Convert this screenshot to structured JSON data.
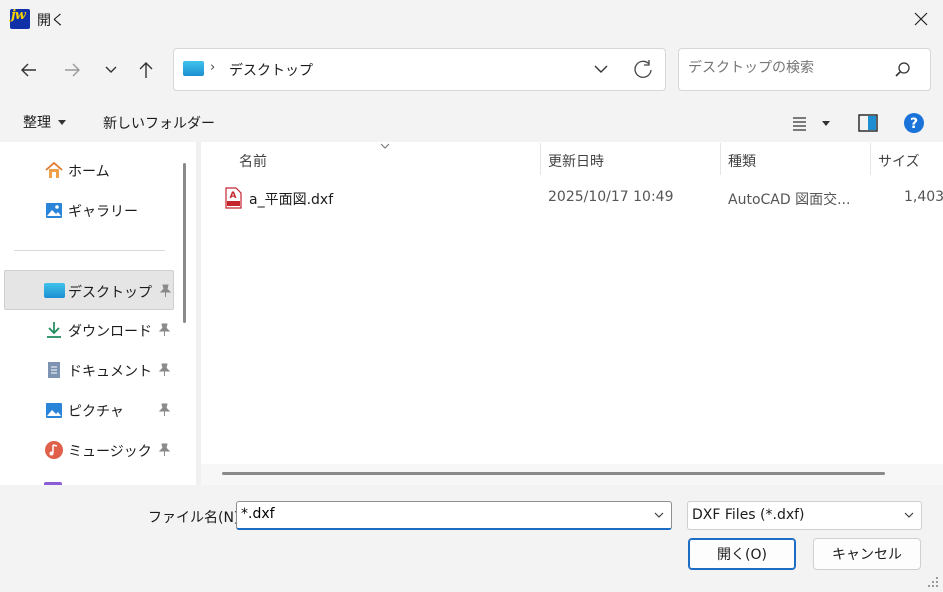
{
  "window": {
    "title": "開く",
    "app_logo_text": "jw"
  },
  "nav_buttons": {
    "back": "arrow-left-icon",
    "forward": "arrow-right-icon",
    "recent": "chevron-down-icon",
    "up": "arrow-up-icon"
  },
  "address": {
    "path": "デスクトップ",
    "separator": "›"
  },
  "search": {
    "placeholder": "デスクトップの検索"
  },
  "toolbar": {
    "organize_label": "整理",
    "new_folder_label": "新しいフォルダー"
  },
  "sidebar": {
    "items": [
      {
        "label": "ホーム",
        "icon": "home-icon",
        "pinned": false
      },
      {
        "label": "ギャラリー",
        "icon": "gallery-icon",
        "pinned": false
      },
      {
        "label": "デスクトップ",
        "icon": "desktop-icon",
        "pinned": true,
        "selected": true
      },
      {
        "label": "ダウンロード",
        "icon": "download-icon",
        "pinned": true
      },
      {
        "label": "ドキュメント",
        "icon": "document-icon",
        "pinned": true
      },
      {
        "label": "ピクチャ",
        "icon": "pictures-icon",
        "pinned": true
      },
      {
        "label": "ミュージック",
        "icon": "music-icon",
        "pinned": true
      }
    ]
  },
  "file_list": {
    "columns": [
      "名前",
      "更新日時",
      "種類",
      "サイズ"
    ],
    "rows": [
      {
        "name": "a_平面図.dxf",
        "modified": "2025/10/17 10:49",
        "type": "AutoCAD 図面交...",
        "size": "1,403",
        "icon": "dxf-file-icon"
      }
    ]
  },
  "footer": {
    "filename_label": "ファイル名(N):",
    "filename_value": "*.dxf",
    "filetype_value": "DXF Files (*.dxf)",
    "open_label": "開く(O)",
    "cancel_label": "キャンセル"
  },
  "colors": {
    "accent": "#1d6cc4",
    "help": "#1a73d9",
    "app_logo_bg": "#1030a8",
    "app_logo_fg": "#f4d000"
  }
}
